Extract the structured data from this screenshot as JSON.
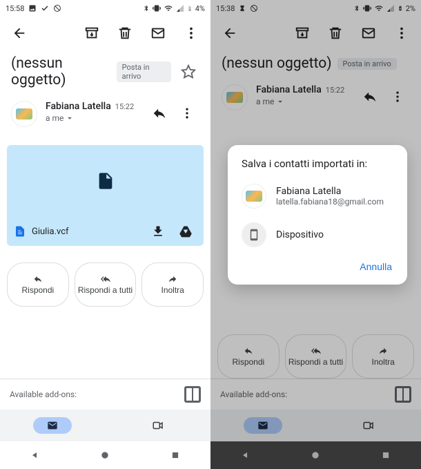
{
  "statusbar": {
    "left": {
      "time": "15:58",
      "battery": "4%"
    },
    "right": {
      "time": "15:38",
      "battery": "2%"
    }
  },
  "subject": "(nessun oggetto)",
  "inbox_chip": "Posta in arrivo",
  "sender": {
    "name": "Fabiana Latella",
    "time": "15:22",
    "to_line": "a me"
  },
  "attachment": {
    "filename": "Giulia.vcf"
  },
  "reply": {
    "reply": "Rispondi",
    "reply_all": "Rispondi a tutti",
    "forward": "Inoltra"
  },
  "addons": "Available add-ons:",
  "dialog": {
    "title": "Salva i contatti importati in:",
    "account_name": "Fabiana Latella",
    "account_email": "latella.fabiana18@gmail.com",
    "device": "Dispositivo",
    "cancel": "Annulla"
  }
}
